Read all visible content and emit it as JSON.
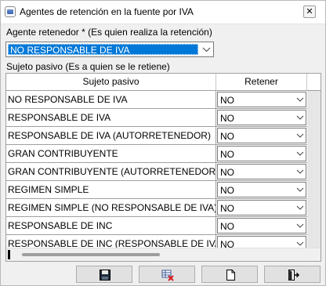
{
  "window": {
    "title": "Agentes de retención en la fuente por IVA",
    "close_label": "✕"
  },
  "agente": {
    "label": "Agente retenedor * (Es quien realiza la retención)",
    "selected": "NO RESPONSABLE DE IVA"
  },
  "sujeto_label": "Sujeto pasivo (Es a quien se le retiene)",
  "grid": {
    "columns": [
      "Sujeto pasivo",
      "Retener"
    ],
    "rows": [
      {
        "name": "NO RESPONSABLE DE IVA",
        "value": "NO"
      },
      {
        "name": "RESPONSABLE DE IVA",
        "value": "NO"
      },
      {
        "name": "RESPONSABLE DE IVA (AUTORRETENEDOR)",
        "value": "NO"
      },
      {
        "name": "GRAN CONTRIBUYENTE",
        "value": "NO"
      },
      {
        "name": "GRAN CONTRIBUYENTE (AUTORRETENEDOR)",
        "value": "NO"
      },
      {
        "name": "REGIMEN SIMPLE",
        "value": "NO"
      },
      {
        "name": "REGIMEN SIMPLE (NO RESPONSABLE DE IVA)",
        "value": "NO"
      },
      {
        "name": "RESPONSABLE DE INC",
        "value": "NO"
      },
      {
        "name": "RESPONSABLE DE INC (RESPONSABLE DE IVA)",
        "value": "NO"
      }
    ]
  },
  "footer": {
    "buttons": [
      "save-icon",
      "cancel-edit-icon",
      "new-document-icon",
      "exit-icon"
    ]
  },
  "colors": {
    "selection": "#0078d7",
    "window_bg": "#f0f0f0",
    "grid_line": "#a0a0a0"
  }
}
